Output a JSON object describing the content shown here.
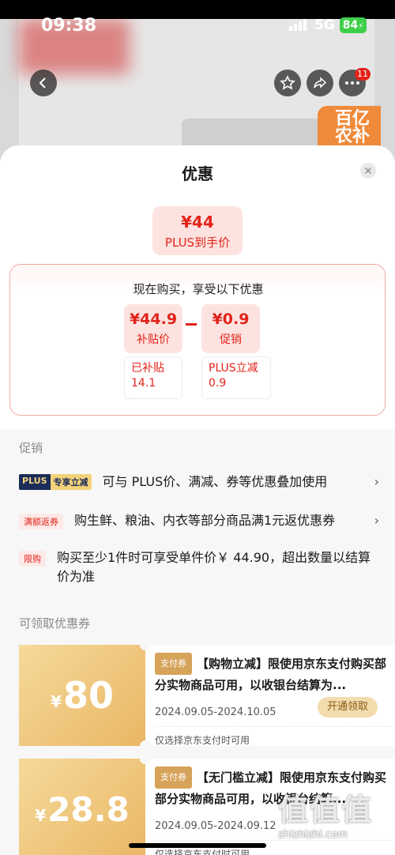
{
  "status": {
    "time": "09:38",
    "network": "5G",
    "battery": "84"
  },
  "background": {
    "badge": "百亿\n农补",
    "notif_count": "11"
  },
  "sheet": {
    "title": "优惠",
    "plus_price": {
      "amount": "¥44",
      "label": "PLUS到手价"
    },
    "calc": {
      "heading": "现在购买，享受以下优惠",
      "left": {
        "amount": "¥44.9",
        "label": "补贴价",
        "detail_1": "已补贴",
        "detail_2": "14.1"
      },
      "right": {
        "amount": "¥0.9",
        "label": "促销",
        "detail_1": "PLUS立减",
        "detail_2": "0.9"
      }
    },
    "promo_section_title": "促销",
    "promos": [
      {
        "tag_1": "PLUS",
        "tag_2": "专享立减",
        "text": "可与 PLUS价、满减、券等优惠叠加使用",
        "chevron": "›"
      },
      {
        "tag": "满额返券",
        "text": "购生鲜、粮油、内衣等部分商品满1元返优惠券",
        "chevron": "›"
      },
      {
        "tag": "限购",
        "text": "购买至少1件时可享受单件价￥ 44.90，超出数量以结算价为准"
      }
    ],
    "coupon_section_title": "可领取优惠券",
    "coupons": [
      {
        "currency": "¥",
        "value": "80",
        "pay_tag": "支付券",
        "desc": "【购物立减】限使用京东支付购买部分实物商品可用，以收银台结算为...",
        "date": "2024.09.05-2024.10.05",
        "note": "仅选择京东支付时可用",
        "button": "开通领取"
      },
      {
        "currency": "¥",
        "value": "28.8",
        "pay_tag": "支付券",
        "desc": "【无门槛立减】限使用京东支付购买部分实物商品可用，以收银台结算...",
        "date": "2024.09.05-2024.09.12",
        "note": "仅选择京东支付时可用"
      }
    ]
  },
  "watermark": {
    "big": "值值值",
    "url": "zhizhizhi.com"
  },
  "colors": {
    "accent_red": "#e2231a",
    "plus_navy": "#1c2c5a",
    "coupon_gold": "#e9b765"
  }
}
